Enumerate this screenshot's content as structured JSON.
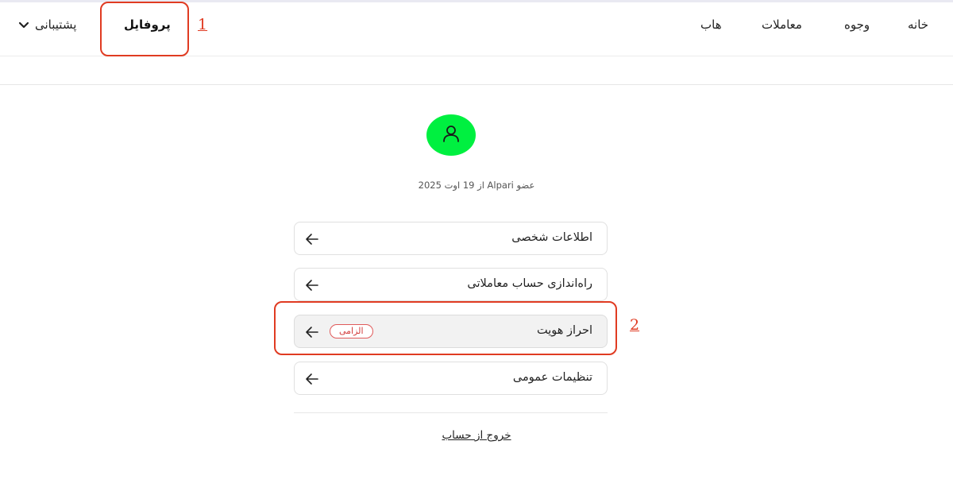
{
  "nav": {
    "links": {
      "home": "خانه",
      "funds": "وجوه",
      "trades": "معاملات",
      "hub": "هاب"
    },
    "profile": "پروفایل",
    "support": "پشتیبانی"
  },
  "annotations": {
    "first": "1",
    "second": "2"
  },
  "profile": {
    "member_since": "عضو Alpari از 19 اوت 2025",
    "avatar_color": "#00f040"
  },
  "menu": {
    "items": [
      {
        "label": "اطلاعات شخصی"
      },
      {
        "label": "راه‌اندازی حساب معاملاتی"
      },
      {
        "label": "احراز هویت",
        "badge": "الزامی"
      },
      {
        "label": "تنظیمات عمومی"
      }
    ]
  },
  "logout": "خروج از حساب",
  "colors": {
    "highlight": "#e03b22",
    "badge": "#d23a3a"
  }
}
